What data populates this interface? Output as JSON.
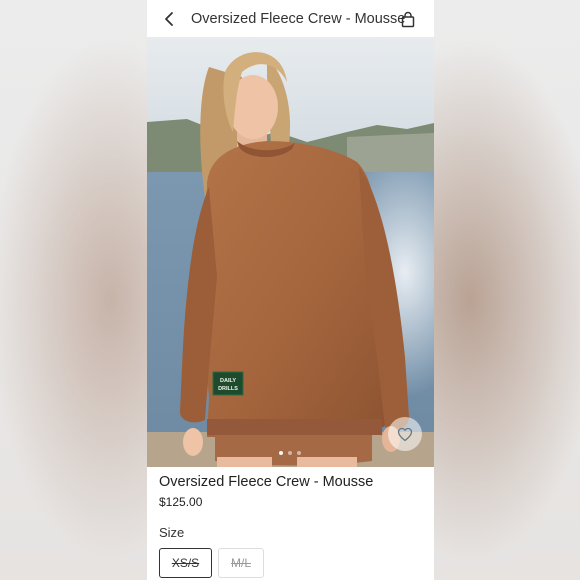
{
  "header": {
    "title": "Oversized Fleece Crew - Mousse"
  },
  "product": {
    "name": "Oversized Fleece Crew - Mousse",
    "price": "$125.00",
    "patch_text": [
      "DAILY",
      "DRILLS"
    ]
  },
  "size": {
    "label": "Size",
    "options": [
      {
        "label": "XS/S",
        "available": false,
        "selected": true
      },
      {
        "label": "M/L",
        "available": false,
        "selected": false
      }
    ]
  },
  "gallery": {
    "image_count": 3,
    "active_index": 0
  },
  "icons": {
    "back": "chevron-left-icon",
    "bag": "shopping-bag-icon",
    "favorite": "heart-icon"
  },
  "colors": {
    "sweater": "#a8673f",
    "patch": "#1e4a2e"
  }
}
